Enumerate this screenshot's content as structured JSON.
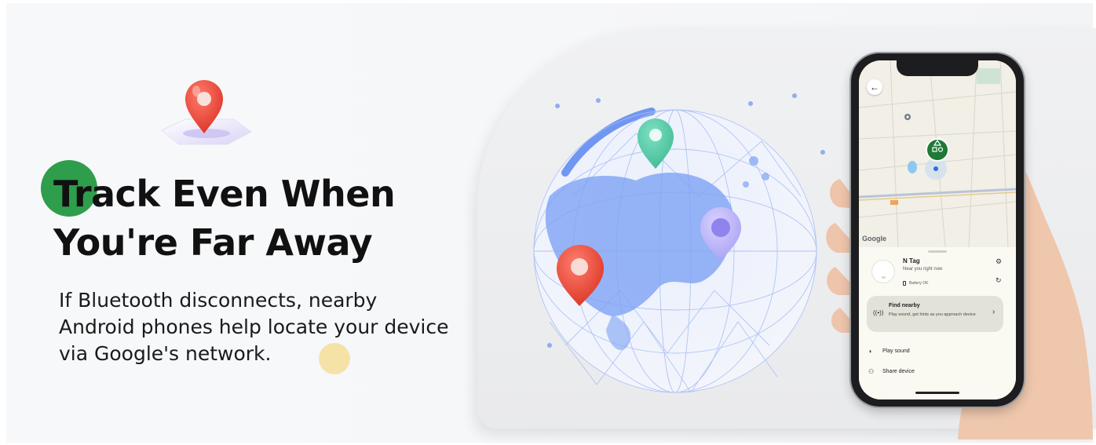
{
  "headline": {
    "line1": "Track Even When",
    "line2": "You're Far Away"
  },
  "body": {
    "line1": "If Bluetooth disconnects, nearby",
    "line2": "Android phones help locate your device",
    "line3": "via Google's network."
  },
  "colors": {
    "accent_green": "#2e9e4c",
    "accent_yellow": "#f5e2a6",
    "pin_red": "#e84a3c",
    "pin_teal": "#4ec7a6",
    "pin_purple": "#b7b0f7",
    "globe_blue": "#6f97f2"
  },
  "phone": {
    "map": {
      "google_label": "Google",
      "back_icon": "arrow-left-icon"
    },
    "device": {
      "name": "N Tag",
      "status": "Near you right now",
      "battery": "Battery OK"
    },
    "find_nearby": {
      "title": "Find nearby",
      "subtitle": "Play sound, get hints as you approach device"
    },
    "actions": [
      {
        "label": "Play sound",
        "icon": "speaker-icon"
      },
      {
        "label": "Share device",
        "icon": "add-person-icon"
      }
    ]
  }
}
